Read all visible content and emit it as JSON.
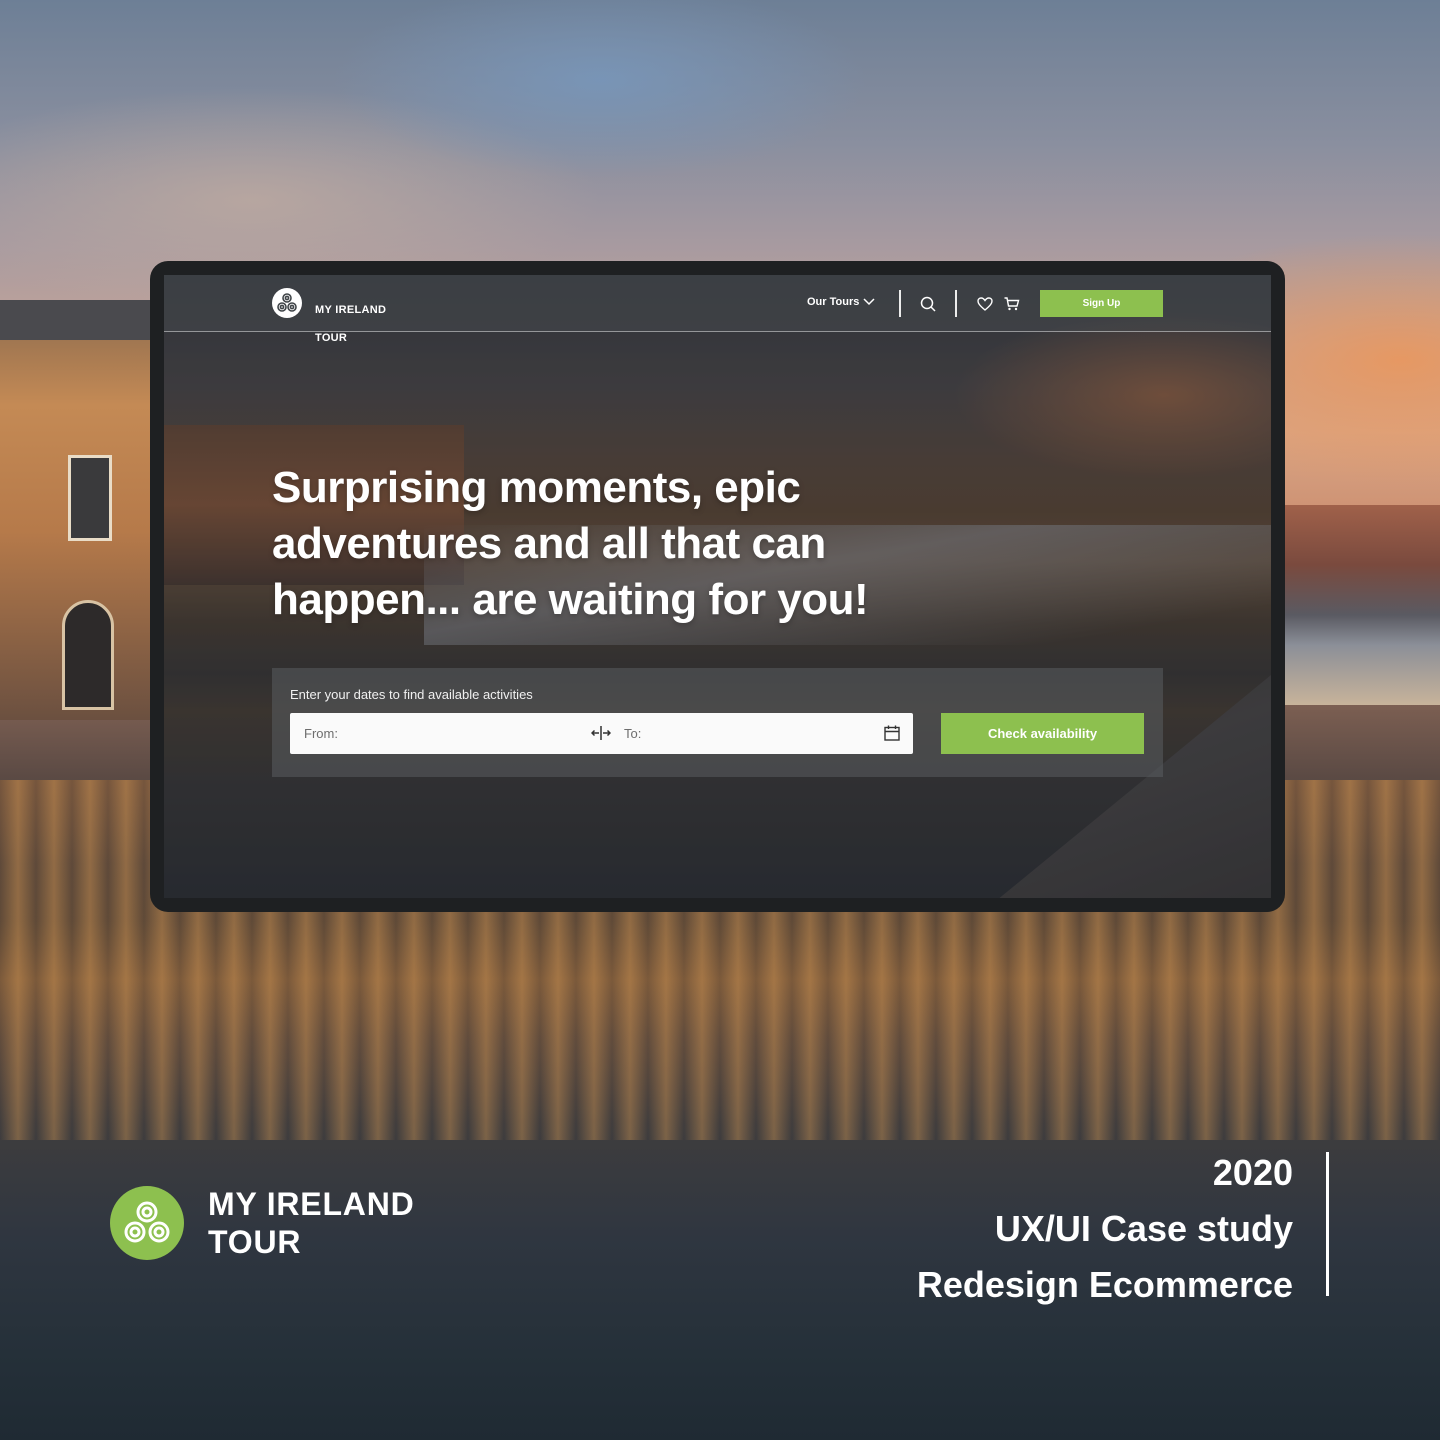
{
  "brand": {
    "name_line1": "MY IRELAND",
    "name_line2": "TOUR",
    "accent_color": "#8dc04f",
    "logo_icon": "triskele-icon"
  },
  "mockup": {
    "nav": {
      "brand_line1": "MY IRELAND",
      "brand_line2": "TOUR",
      "tours_label": "Our Tours",
      "icons": [
        "chevron-down-icon",
        "search-icon",
        "heart-icon",
        "cart-icon"
      ],
      "signup_label": "Sign Up"
    },
    "hero": {
      "headline": "Surprising moments, epic adventures and all that can happen... are waiting for you!"
    },
    "search": {
      "hint": "Enter your dates to find available activities",
      "from_label": "From:",
      "to_label": "To:",
      "swap_icon": "swap-arrows-icon",
      "calendar_icon": "calendar-icon",
      "button_label": "Check availability"
    }
  },
  "case_study": {
    "year": "2020",
    "line1": "UX/UI Case study",
    "line2": "Redesign Ecommerce"
  }
}
